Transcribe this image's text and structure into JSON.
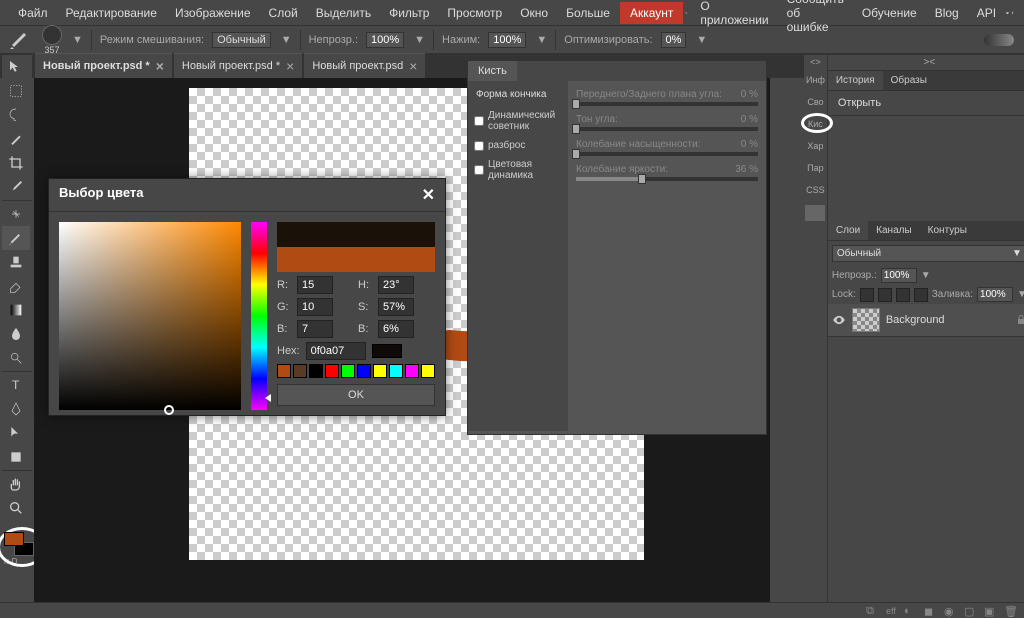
{
  "menubar": {
    "items": [
      "Файл",
      "Редактирование",
      "Изображение",
      "Слой",
      "Выделить",
      "Фильтр",
      "Просмотр",
      "Окно",
      "Больше"
    ],
    "account": "Аккаунт",
    "right_items": [
      "О приложении",
      "Сообщить об ошибке",
      "Обучение",
      "Blog",
      "API"
    ]
  },
  "options": {
    "brush_size": "357",
    "blend_label": "Режим смешивания:",
    "blend_value": "Обычный",
    "opacity_label": "Непрозр.:",
    "opacity_value": "100%",
    "pressure_label": "Нажим:",
    "pressure_value": "100%",
    "optimize_label": "Оптимизировать:",
    "optimize_value": "0%"
  },
  "tabs": [
    {
      "label": "Новый проект.psd *",
      "active": true
    },
    {
      "label": "Новый проект.psd *",
      "active": false
    },
    {
      "label": "Новый проект.psd",
      "active": false
    }
  ],
  "color_picker": {
    "title": "Выбор цвета",
    "r_label": "R:",
    "r_value": "15",
    "g_label": "G:",
    "g_value": "10",
    "b_label": "B:",
    "b_value": "7",
    "h_label": "H:",
    "h_value": "23°",
    "s_label": "S:",
    "s_value": "57%",
    "bb_label": "B:",
    "bb_value": "6%",
    "hex_label": "Hex:",
    "hex_value": "0f0a07",
    "ok": "OK",
    "preview_top": "#1a1108",
    "preview_bottom": "#b04b13",
    "palette": [
      "#b04b13",
      "#5a3a22",
      "#000",
      "#f00",
      "#0f0",
      "#00f",
      "#ff0",
      "#0ff",
      "#f0f",
      "#ff0"
    ]
  },
  "brush_panel": {
    "tab": "Кисть",
    "sections": {
      "tip": "Форма кончика",
      "dynamics": "Динамический советник",
      "scatter": "разброс",
      "color_dyn": "Цветовая динамика"
    },
    "sliders": {
      "fg_bg_label": "Переднего/Заднего плана угла:",
      "fg_bg_value": "0 %",
      "hue_label": "Тон угла:",
      "hue_value": "0 %",
      "sat_label": "Колебание насыщенности:",
      "sat_value": "0 %",
      "bright_label": "Колебание яркости:",
      "bright_value": "36 %"
    }
  },
  "right_strip": {
    "items": [
      "Инф",
      "Сво",
      "Кис",
      "Хар",
      "Пар",
      "CSS"
    ]
  },
  "history_panel": {
    "tabs": [
      "История",
      "Образы"
    ],
    "active_tab": "История",
    "item": "Открыть"
  },
  "layers_panel": {
    "tabs": [
      "Слои",
      "Каналы",
      "Контуры"
    ],
    "active_tab": "Слои",
    "blend_mode": "Обычный",
    "opacity_label": "Непрозр.:",
    "opacity_value": "100%",
    "lock_label": "Lock:",
    "fill_label": "Заливка:",
    "fill_value": "100%",
    "layers": [
      {
        "name": "Background",
        "locked": true
      }
    ]
  },
  "statusbar": {
    "eff": "eff"
  },
  "colors": {
    "brush_stroke": "#b04b13",
    "foreground": "#b04b13",
    "background": "#000000"
  }
}
